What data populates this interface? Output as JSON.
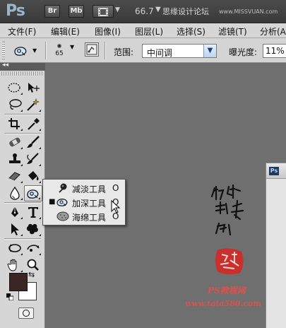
{
  "app": {
    "logo": "Ps",
    "bridge_button": "Br",
    "minibridge_button": "Mb",
    "zoom_level": "66.7",
    "watermark_site": "思缘设计论坛",
    "watermark_url": "www.MISSVUAN.com"
  },
  "menu": {
    "items": [
      "文件(F)",
      "编辑(E)",
      "图像(I)",
      "图层(L)",
      "选择(S)",
      "滤镜(T)",
      "分析(A)"
    ]
  },
  "options": {
    "brush_size": "65",
    "range_label": "范围:",
    "range_value": "中间调",
    "exposure_label": "曝光度:",
    "exposure_value": "11%"
  },
  "tools": {
    "foreground_color": "#3a2622",
    "background_color": "#ffffff"
  },
  "flyout": {
    "items": [
      {
        "label": "减淡工具",
        "shortcut": "O",
        "selected": false,
        "icon": "dodge-icon"
      },
      {
        "label": "加深工具",
        "shortcut": "O",
        "selected": true,
        "icon": "burn-icon"
      },
      {
        "label": "海绵工具",
        "shortcut": "O",
        "selected": false,
        "icon": "sponge-icon"
      }
    ]
  },
  "document": {
    "icon_label": "Ps"
  },
  "watermark": {
    "brand": "PS教程网",
    "url": "www.tata580.com",
    "accent_color": "#d9534f"
  }
}
